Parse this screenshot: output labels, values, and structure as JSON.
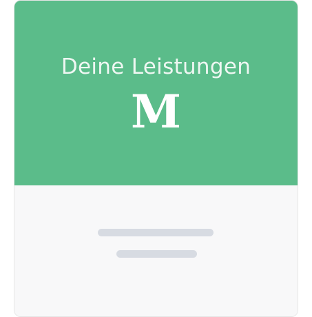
{
  "card": {
    "title": "Deine Leistungen",
    "tier_letter": "M",
    "body": {
      "loading_placeholder_lines": 2
    }
  },
  "colors": {
    "accent": "#5bbc8a",
    "header_text": "#eef7f2",
    "body_background": "#f8f8f9",
    "skeleton": "#d7dbe2"
  }
}
